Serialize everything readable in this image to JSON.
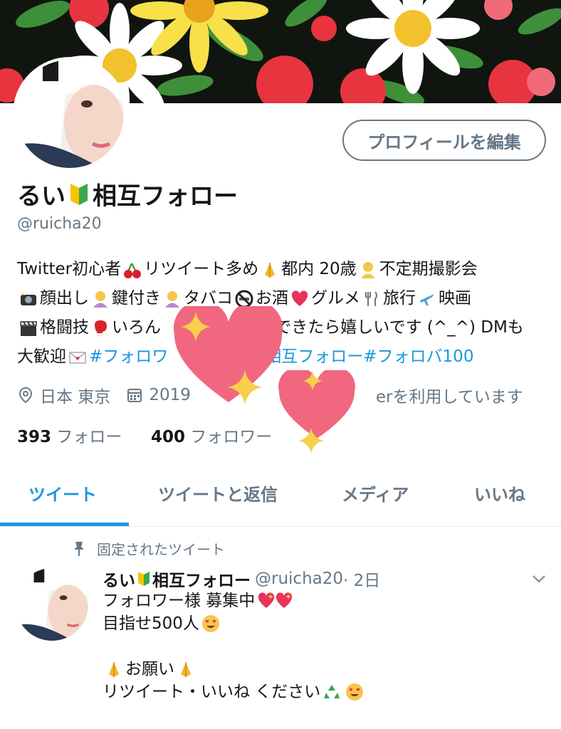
{
  "profile": {
    "edit_button": "プロフィールを編集",
    "name": "るい",
    "name_suffix": "相互フォロー",
    "handle": "@ruicha20",
    "bio": {
      "l1a": "Twitter初心者",
      "l1b": " リツイート多め",
      "l1c": " 都内 20歳",
      "l1d": " 不定期撮影会",
      "l2a": " 顔出し",
      "l2b": " 鍵付き",
      "l2c": " タバコ",
      "l2d": " お酒",
      "l2e": " グルメ",
      "l2f": " 旅行",
      "l2g": " 映画",
      "l3a": " 格闘技",
      "l3b": " いろん",
      "l3c": "仲良くできたら嬉しいです (^_^) DMも",
      "l4a": "大歓迎",
      "l4b": " #フォロワ",
      "l4c": "相互フォロー",
      "l4d": " #フォロバ100"
    },
    "location": "日本 東京",
    "joined_prefix": "2019",
    "joined_suffix": "erを利用しています",
    "following_count": "393",
    "following_label": " フォロー",
    "followers_count": "400",
    "followers_label": " フォロワー"
  },
  "tabs": [
    "ツイート",
    "ツイートと返信",
    "メディア",
    "いいね"
  ],
  "active_tab": "ツイート",
  "pinned_tweet": {
    "pinned_label": "固定されたツイート",
    "name": "るい",
    "name_suffix": "相互フォロー",
    "handle": "@ruicha20",
    "time": " · 2日",
    "line1": "フォロワー様 募集中",
    "line2": "目指せ500人",
    "line3": "お願い",
    "line4": "リツイート・いいね ください"
  },
  "colors": {
    "accent": "#1b95e0",
    "secondary_text": "#657786",
    "sticker_heart": "#f0677f",
    "sticker_star": "#f7cf4a"
  },
  "icons": [
    "beginner-mark-icon",
    "location-pin-icon",
    "calendar-icon",
    "pin-icon",
    "chevron-down-icon",
    "heart-sticker",
    "sparkle-sticker"
  ]
}
